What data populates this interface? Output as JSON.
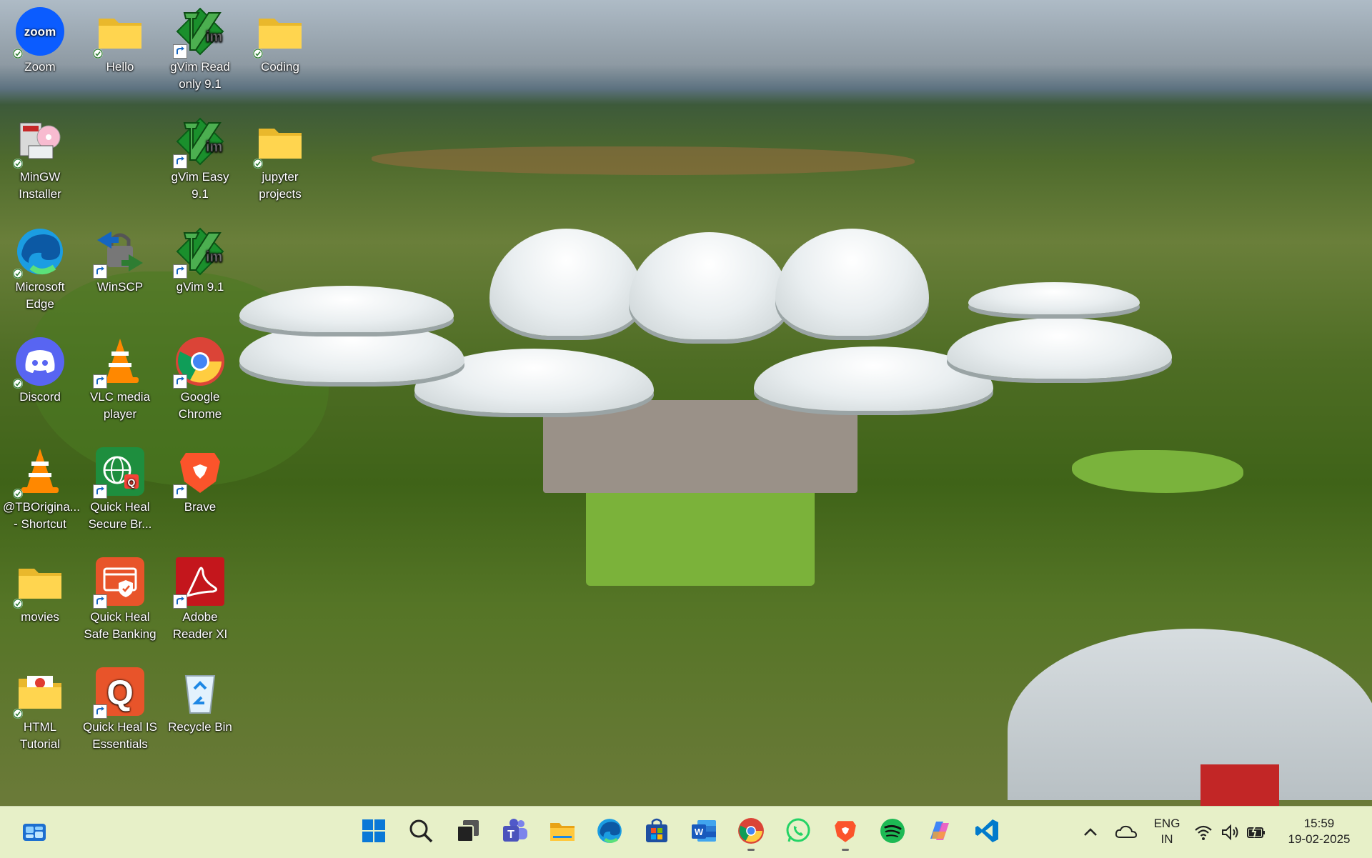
{
  "desktop": {
    "icons": [
      {
        "id": "zoom",
        "label": "Zoom",
        "icon": "zoom-icon",
        "col": 0,
        "row": 0,
        "badge": "sync"
      },
      {
        "id": "hello",
        "label": "Hello",
        "icon": "folder-icon",
        "col": 1,
        "row": 0,
        "badge": "sync"
      },
      {
        "id": "gvim-read",
        "label": "gVim Read\nonly 9.1",
        "icon": "gvim-icon",
        "col": 2,
        "row": 0,
        "badge": "shortcut"
      },
      {
        "id": "coding",
        "label": "Coding",
        "icon": "folder-icon",
        "col": 3,
        "row": 0,
        "badge": "sync"
      },
      {
        "id": "mingw",
        "label": "MinGW\nInstaller",
        "icon": "mingw-installer-icon",
        "col": 0,
        "row": 1,
        "badge": "sync"
      },
      {
        "id": "gvim-easy",
        "label": "gVim Easy\n9.1",
        "icon": "gvim-icon",
        "col": 2,
        "row": 1,
        "badge": "shortcut"
      },
      {
        "id": "jupyter",
        "label": "jupyter\nprojects",
        "icon": "folder-icon",
        "col": 3,
        "row": 1,
        "badge": "sync"
      },
      {
        "id": "edge",
        "label": "Microsoft\nEdge",
        "icon": "edge-icon",
        "col": 0,
        "row": 2,
        "badge": "sync"
      },
      {
        "id": "winscp",
        "label": "WinSCP",
        "icon": "winscp-icon",
        "col": 1,
        "row": 2,
        "badge": "shortcut"
      },
      {
        "id": "gvim",
        "label": "gVim 9.1",
        "icon": "gvim-icon",
        "col": 2,
        "row": 2,
        "badge": "shortcut"
      },
      {
        "id": "discord",
        "label": "Discord",
        "icon": "discord-icon",
        "col": 0,
        "row": 3,
        "badge": "sync"
      },
      {
        "id": "vlc",
        "label": "VLC media\nplayer",
        "icon": "vlc-icon",
        "col": 1,
        "row": 3,
        "badge": "shortcut"
      },
      {
        "id": "chrome",
        "label": "Google\nChrome",
        "icon": "chrome-icon",
        "col": 2,
        "row": 3,
        "badge": "shortcut"
      },
      {
        "id": "tborigina",
        "label": "@TBOrigina...\n- Shortcut",
        "icon": "vlc-icon",
        "col": 0,
        "row": 4,
        "badge": "sync"
      },
      {
        "id": "qh-browser",
        "label": "Quick Heal\nSecure Br...",
        "icon": "quick-heal-browser-icon",
        "col": 1,
        "row": 4,
        "badge": "shortcut"
      },
      {
        "id": "brave",
        "label": "Brave",
        "icon": "brave-icon",
        "col": 2,
        "row": 4,
        "badge": "shortcut"
      },
      {
        "id": "movies",
        "label": "movies",
        "icon": "folder-icon",
        "col": 0,
        "row": 5,
        "badge": "sync"
      },
      {
        "id": "qh-banking",
        "label": "Quick Heal\nSafe Banking",
        "icon": "quick-heal-banking-icon",
        "col": 1,
        "row": 5,
        "badge": "shortcut"
      },
      {
        "id": "adobe",
        "label": "Adobe\nReader XI",
        "icon": "adobe-reader-icon",
        "col": 2,
        "row": 5,
        "badge": "shortcut"
      },
      {
        "id": "html-tutorial",
        "label": "HTML\nTutorial",
        "icon": "html-folder-icon",
        "col": 0,
        "row": 6,
        "badge": "sync"
      },
      {
        "id": "qh-essentials",
        "label": "Quick Heal IS\nEssentials",
        "icon": "quick-heal-q-icon",
        "col": 1,
        "row": 6,
        "badge": "shortcut"
      },
      {
        "id": "recycle",
        "label": "Recycle Bin",
        "icon": "recycle-bin-icon",
        "col": 2,
        "row": 6,
        "badge": "none"
      }
    ]
  },
  "taskbar": {
    "widgets": "widgets-icon",
    "apps": [
      {
        "id": "start",
        "icon": "windows-start-icon"
      },
      {
        "id": "search",
        "icon": "search-icon"
      },
      {
        "id": "taskview",
        "icon": "task-view-icon"
      },
      {
        "id": "teams",
        "icon": "teams-icon"
      },
      {
        "id": "explorer",
        "icon": "file-explorer-icon"
      },
      {
        "id": "edge",
        "icon": "edge-icon"
      },
      {
        "id": "store",
        "icon": "microsoft-store-icon"
      },
      {
        "id": "word",
        "icon": "word-icon"
      },
      {
        "id": "chrome",
        "icon": "chrome-icon",
        "running": true
      },
      {
        "id": "whatsapp",
        "icon": "whatsapp-icon"
      },
      {
        "id": "brave",
        "icon": "brave-icon",
        "running": true
      },
      {
        "id": "spotify",
        "icon": "spotify-icon"
      },
      {
        "id": "copilot",
        "icon": "copilot-icon"
      },
      {
        "id": "vscode",
        "icon": "vscode-icon"
      }
    ],
    "tray": {
      "lang_line1": "ENG",
      "lang_line2": "IN",
      "time": "15:59",
      "date": "19-02-2025"
    }
  }
}
